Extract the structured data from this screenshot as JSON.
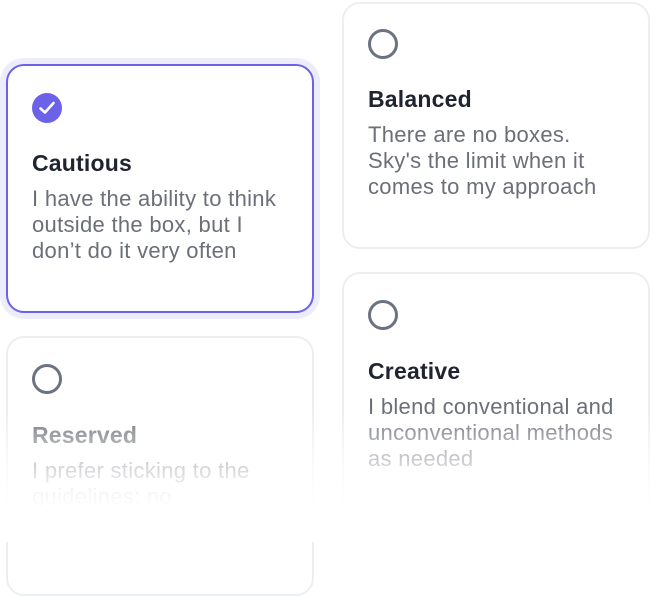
{
  "options": {
    "cautious": {
      "title": "Cautious",
      "description": "I have the ability to think outside the box, but I don’t do it very often",
      "selected": true
    },
    "balanced": {
      "title": "Balanced",
      "description": "There are no boxes. Sky's the limit when it comes to my approach",
      "selected": false
    },
    "reserved": {
      "title": "Reserved",
      "description": "I prefer sticking to the guidelines; no",
      "selected": false
    },
    "creative": {
      "title": "Creative",
      "description": "I blend conventional and unconventional methods as needed",
      "selected": false
    }
  },
  "colors": {
    "accent": "#6b62e8",
    "title_text": "#1f2430",
    "body_text": "#6b6f78",
    "border": "#eceef2",
    "radio_border": "#6b7280"
  },
  "icons": {
    "selected": "check-circle-icon",
    "unselected": "radio-empty-icon"
  }
}
